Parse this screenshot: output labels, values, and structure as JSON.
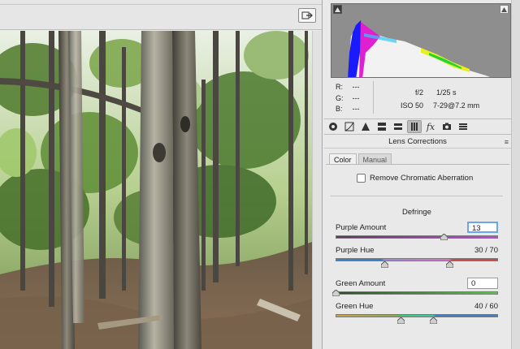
{
  "readout": {
    "r_label": "R:",
    "r_value": "---",
    "g_label": "G:",
    "g_value": "---",
    "b_label": "B:",
    "b_value": "---",
    "aperture": "f/2",
    "shutter": "1/25 s",
    "iso": "ISO 50",
    "focal": "7-29@7.2 mm"
  },
  "toolbar": {
    "items": [
      "basic-icon",
      "tone-curve-icon",
      "detail-icon",
      "hsl-icon",
      "split-toning-icon",
      "lens-corrections-icon",
      "fx-icon",
      "camera-calibration-icon",
      "presets-icon"
    ],
    "active": "lens-corrections-icon"
  },
  "section": {
    "title": "Lens Corrections",
    "menu_glyph": "≡"
  },
  "tabs": {
    "color": "Color",
    "manual": "Manual"
  },
  "chromatic": {
    "label": "Remove Chromatic Aberration",
    "checked": false
  },
  "defringe": {
    "title": "Defringe",
    "purple_amount": {
      "label": "Purple Amount",
      "value": "13"
    },
    "purple_hue": {
      "label": "Purple Hue",
      "value": "30 / 70",
      "low": 30,
      "high": 70
    },
    "green_amount": {
      "label": "Green Amount",
      "value": "0"
    },
    "green_hue": {
      "label": "Green Hue",
      "value": "40 / 60",
      "low": 40,
      "high": 60
    }
  },
  "colors": {
    "panel_bg": "#e9e9e9",
    "focus_ring": "#6aa6e8",
    "histogram_bg": "#8e8e8e"
  }
}
